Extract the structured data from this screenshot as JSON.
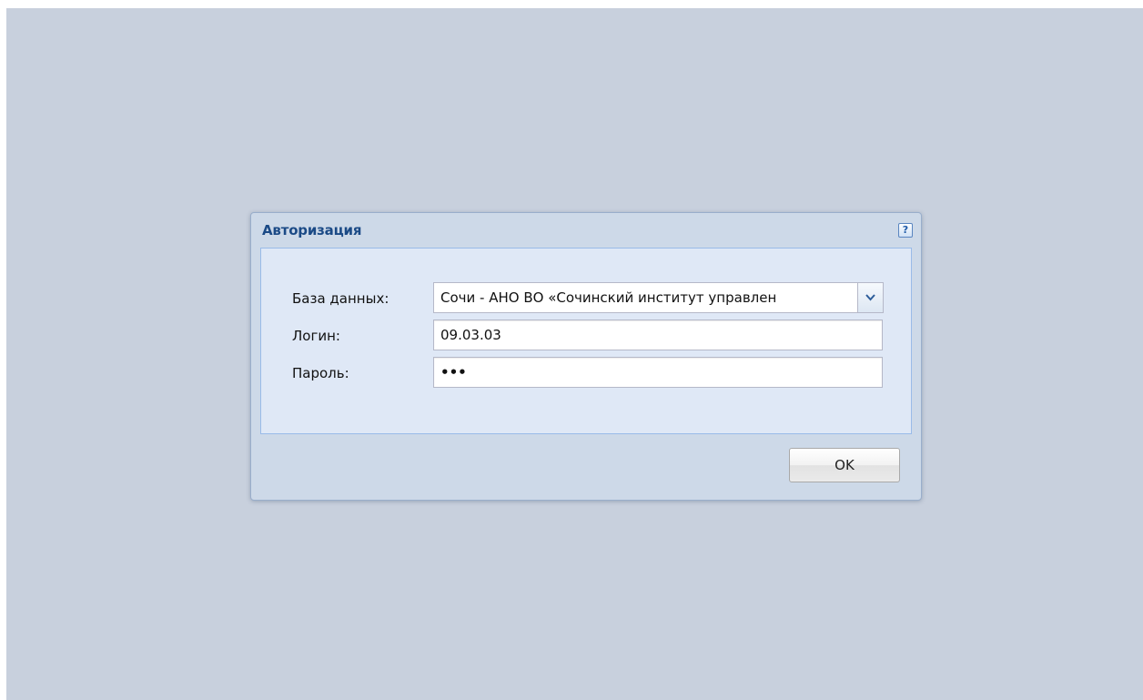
{
  "dialog": {
    "title": "Авторизация",
    "help_label": "?",
    "fields": {
      "database": {
        "label": "База данных:",
        "value": "Сочи - АНО ВО «Сочинский институт управлен"
      },
      "login": {
        "label": "Логин:",
        "value": "09.03.03"
      },
      "password": {
        "label": "Пароль:",
        "masked_value": "•••"
      }
    },
    "ok_label": "OK"
  },
  "colors": {
    "desktop_background": "#c8d0dd",
    "window_background": "#cdd9e8",
    "panel_background": "#dfe8f6",
    "title_color": "#1b4a86"
  },
  "icons": {
    "help": "help-icon",
    "dropdown": "chevron-down-icon"
  }
}
